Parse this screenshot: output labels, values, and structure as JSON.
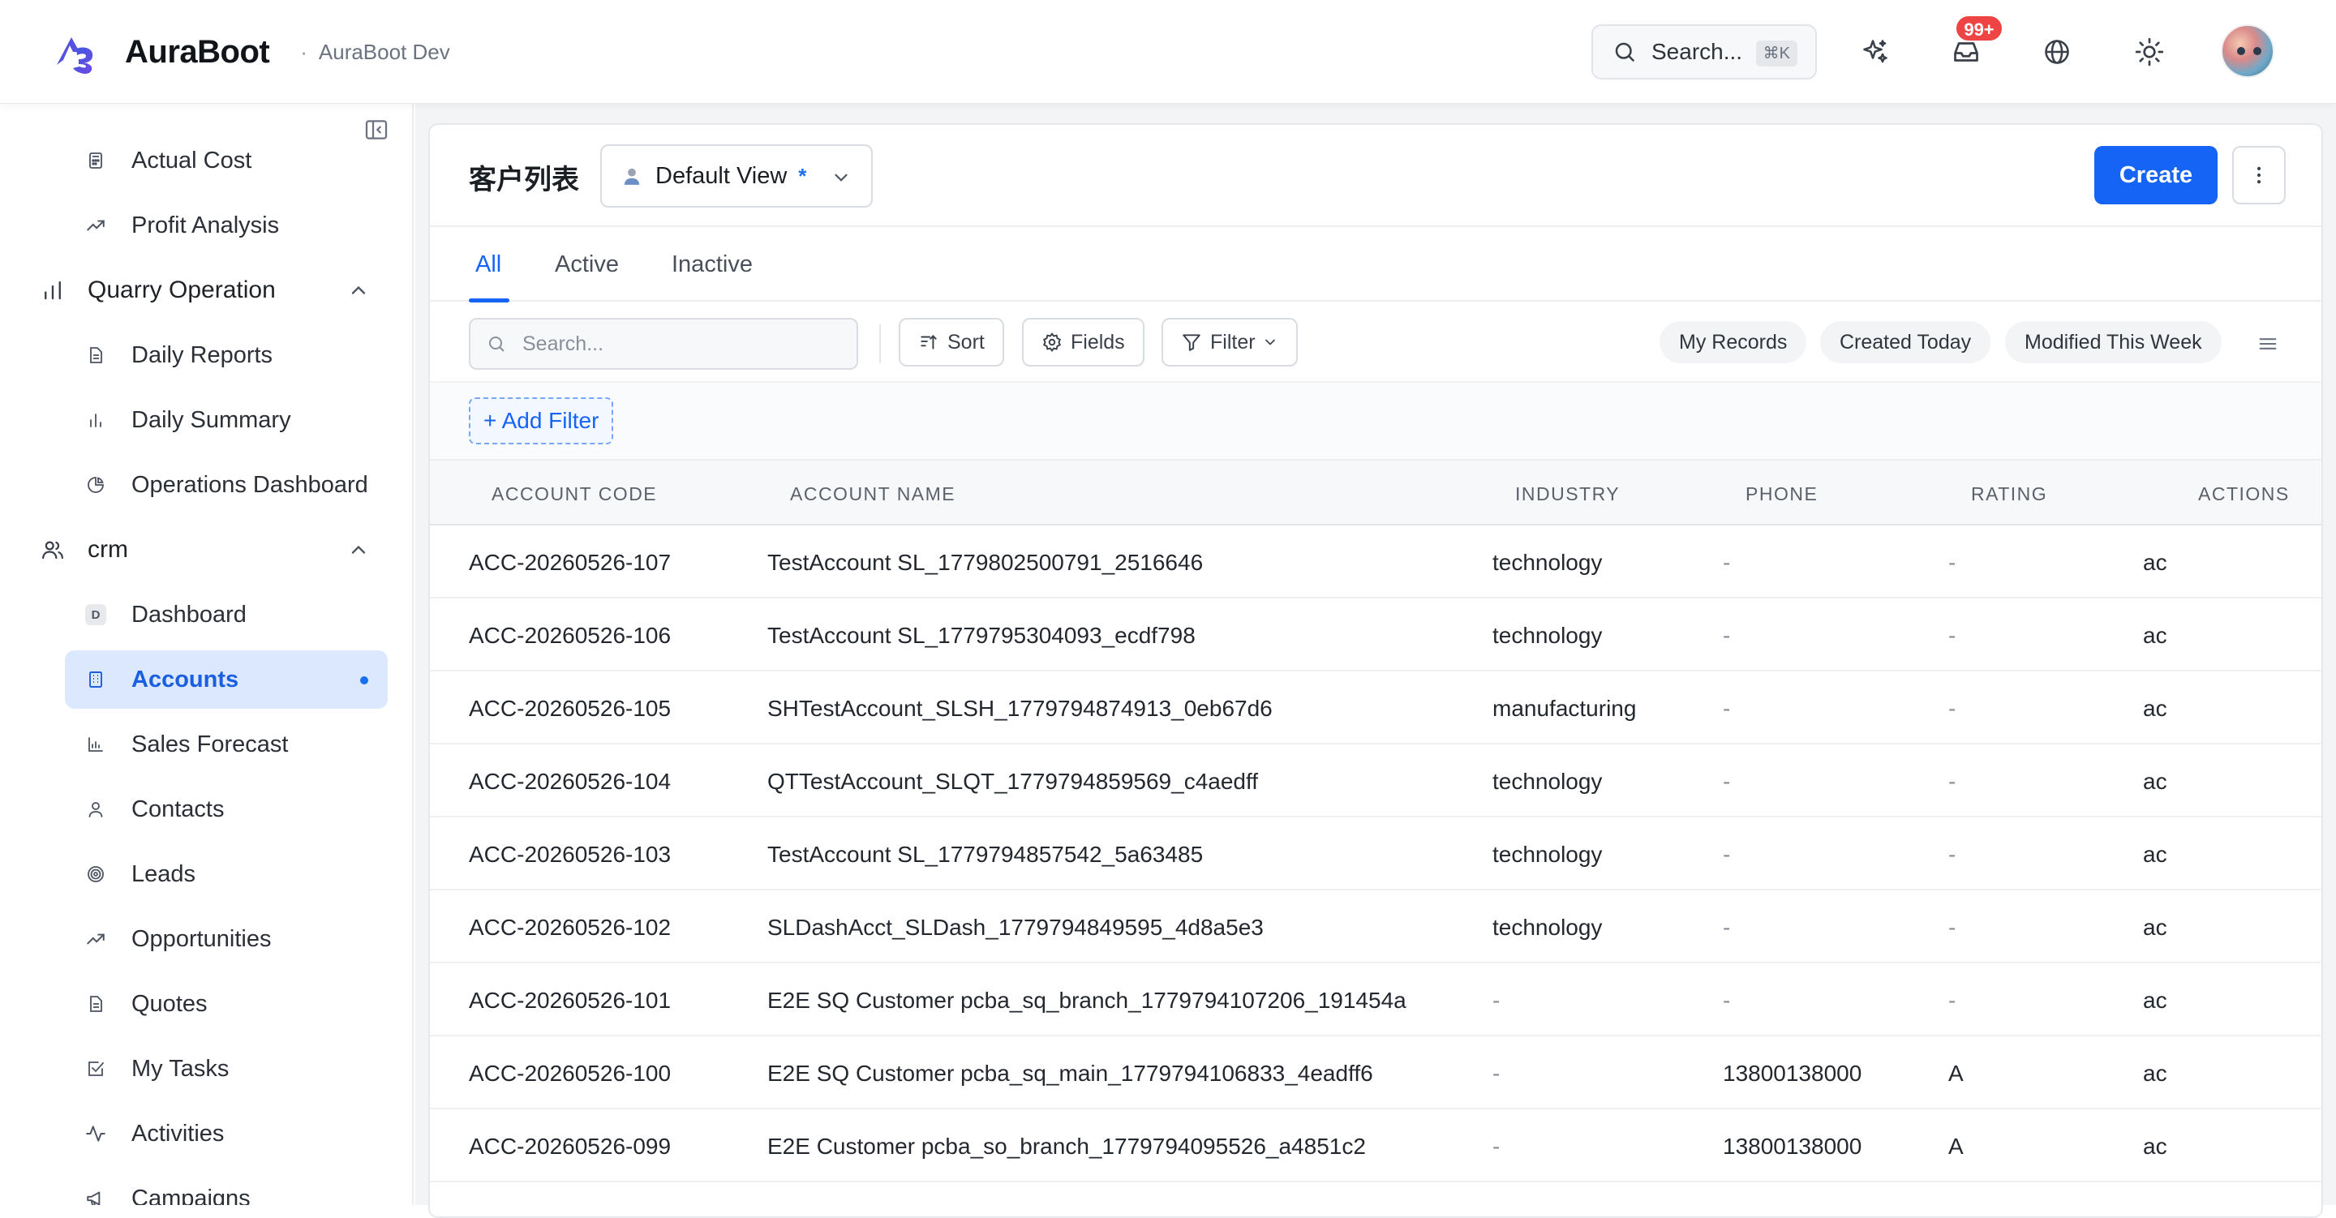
{
  "header": {
    "brand": "AuraBoot",
    "separator": "·",
    "environment": "AuraBoot Dev",
    "search_placeholder": "Search...",
    "search_shortcut": "⌘K",
    "notification_count": "99+"
  },
  "sidebar": {
    "items_top": [
      {
        "label": "Actual Cost",
        "icon": "calculator-icon"
      },
      {
        "label": "Profit Analysis",
        "icon": "trending-up-icon"
      }
    ],
    "group_quarry": {
      "label": "Quarry Operation",
      "icon": "bar-chart-icon"
    },
    "quarry_items": [
      {
        "label": "Daily Reports",
        "icon": "document-icon"
      },
      {
        "label": "Daily Summary",
        "icon": "bar-chart-icon"
      },
      {
        "label": "Operations Dashboard",
        "icon": "pie-chart-icon"
      }
    ],
    "group_crm": {
      "label": "crm",
      "icon": "users-icon"
    },
    "crm_dashboard": {
      "label": "Dashboard",
      "badge": "D"
    },
    "crm_items": [
      {
        "label": "Accounts",
        "icon": "building-icon",
        "active": true
      },
      {
        "label": "Sales Forecast",
        "icon": "area-chart-icon"
      },
      {
        "label": "Contacts",
        "icon": "user-icon"
      },
      {
        "label": "Leads",
        "icon": "target-icon"
      },
      {
        "label": "Opportunities",
        "icon": "trending-up-icon"
      },
      {
        "label": "Quotes",
        "icon": "document-icon"
      },
      {
        "label": "My Tasks",
        "icon": "checkbox-icon"
      },
      {
        "label": "Activities",
        "icon": "activity-icon"
      },
      {
        "label": "Campaigns",
        "icon": "megaphone-icon"
      }
    ]
  },
  "page": {
    "title": "客户列表",
    "view_label": "Default View",
    "view_modified_marker": "*",
    "create_label": "Create"
  },
  "tabs": [
    {
      "label": "All",
      "active": true
    },
    {
      "label": "Active"
    },
    {
      "label": "Inactive"
    }
  ],
  "toolbar": {
    "search_placeholder": "Search...",
    "sort_label": "Sort",
    "fields_label": "Fields",
    "filter_label": "Filter",
    "chips": [
      "My Records",
      "Created Today",
      "Modified This Week"
    ],
    "add_filter_label": "+ Add Filter"
  },
  "table": {
    "columns": [
      "ACCOUNT CODE",
      "ACCOUNT NAME",
      "INDUSTRY",
      "PHONE",
      "RATING",
      "ACTIONS"
    ],
    "rows": [
      {
        "code": "ACC-20260526-107",
        "name": "TestAccount SL_1779802500791_2516646",
        "industry": "technology",
        "phone": "-",
        "rating": "-",
        "actions": "actions"
      },
      {
        "code": "ACC-20260526-106",
        "name": "TestAccount SL_1779795304093_ecdf798",
        "industry": "technology",
        "phone": "-",
        "rating": "-",
        "actions": "actions"
      },
      {
        "code": "ACC-20260526-105",
        "name": "SHTestAccount_SLSH_1779794874913_0eb67d6",
        "industry": "manufacturing",
        "phone": "-",
        "rating": "-",
        "actions": "actions"
      },
      {
        "code": "ACC-20260526-104",
        "name": "QTTestAccount_SLQT_1779794859569_c4aedff",
        "industry": "technology",
        "phone": "-",
        "rating": "-",
        "actions": "actions"
      },
      {
        "code": "ACC-20260526-103",
        "name": "TestAccount SL_1779794857542_5a63485",
        "industry": "technology",
        "phone": "-",
        "rating": "-",
        "actions": "actions"
      },
      {
        "code": "ACC-20260526-102",
        "name": "SLDashAcct_SLDash_1779794849595_4d8a5e3",
        "industry": "technology",
        "phone": "-",
        "rating": "-",
        "actions": "actions"
      },
      {
        "code": "ACC-20260526-101",
        "name": "E2E SQ Customer pcba_sq_branch_1779794107206_191454a",
        "industry": "-",
        "phone": "-",
        "rating": "-",
        "actions": "actions"
      },
      {
        "code": "ACC-20260526-100",
        "name": "E2E SQ Customer pcba_sq_main_1779794106833_4eadff6",
        "industry": "-",
        "phone": "13800138000",
        "rating": "A",
        "actions": "actions"
      },
      {
        "code": "ACC-20260526-099",
        "name": "E2E Customer pcba_so_branch_1779794095526_a4851c2",
        "industry": "-",
        "phone": "13800138000",
        "rating": "A",
        "actions": "actions"
      }
    ]
  },
  "colors": {
    "accent": "#1664f5",
    "active_nav_bg": "#dbe8fd",
    "badge_red": "#ef4444"
  }
}
